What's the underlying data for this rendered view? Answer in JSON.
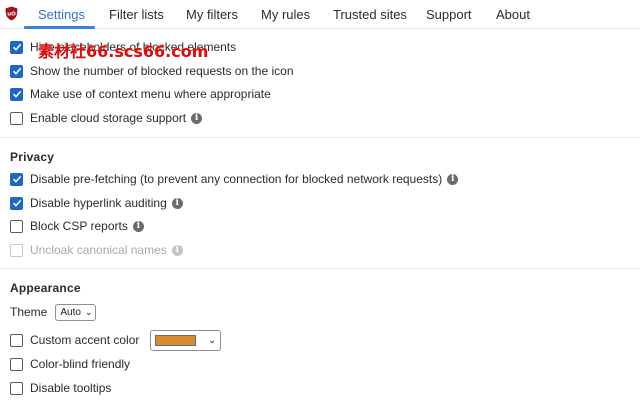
{
  "nav": {
    "tabs": [
      {
        "label": "Settings",
        "active": true
      },
      {
        "label": "Filter lists"
      },
      {
        "label": "My filters"
      },
      {
        "label": "My rules"
      },
      {
        "label": "Trusted sites"
      },
      {
        "label": "Support"
      },
      {
        "label": "About"
      }
    ]
  },
  "general": {
    "items": [
      {
        "label": "Hide placeholders of blocked elements",
        "checked": true
      },
      {
        "label": "Show the number of blocked requests on the icon",
        "checked": true
      },
      {
        "label": "Make use of context menu where appropriate",
        "checked": true
      },
      {
        "label": "Enable cloud storage support",
        "checked": false,
        "info": true
      }
    ]
  },
  "privacy": {
    "title": "Privacy",
    "items": [
      {
        "label": "Disable pre-fetching (to prevent any connection for blocked network requests)",
        "checked": true,
        "info": true
      },
      {
        "label": "Disable hyperlink auditing",
        "checked": true,
        "info": true
      },
      {
        "label": "Block CSP reports",
        "checked": false,
        "info": true
      },
      {
        "label": "Uncloak canonical names",
        "checked": false,
        "info": true,
        "disabled": true
      }
    ]
  },
  "appearance": {
    "title": "Appearance",
    "theme_label": "Theme",
    "theme_value": "Auto",
    "accent_label": "Custom accent color",
    "accent_color": "#d98c2e",
    "items": [
      {
        "label": "Color-blind friendly",
        "checked": false
      },
      {
        "label": "Disable tooltips",
        "checked": false
      }
    ]
  },
  "info_glyph": "i",
  "chevron_glyph": "⌄",
  "watermark": "素材社66.scs66.com",
  "colors": {
    "accent": "#2f74d0",
    "checkbox": "#1d67c9",
    "logo": "#a3141c"
  }
}
